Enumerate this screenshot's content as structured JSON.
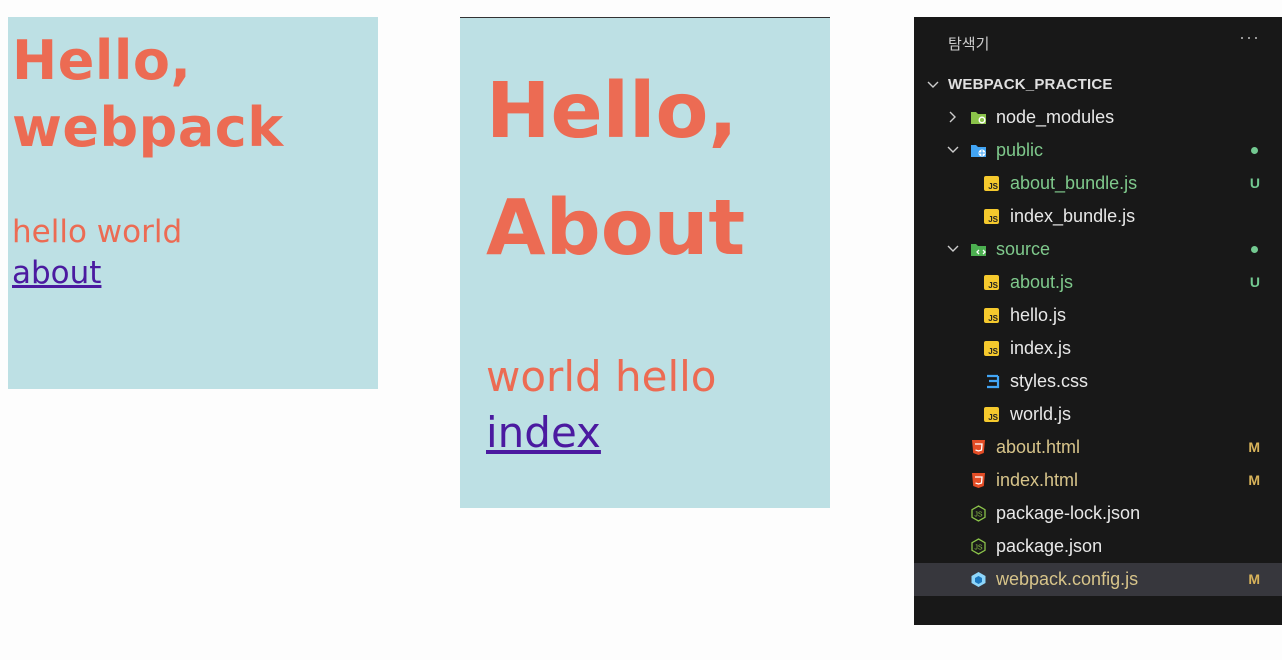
{
  "panel_index": {
    "heading": "Hello, webpack",
    "text": "hello world",
    "link": "about"
  },
  "panel_about": {
    "heading": "Hello, About",
    "text": "world hello",
    "link": "index"
  },
  "explorer": {
    "title": "탐색기",
    "more": "···",
    "root": "WEBPACK_PRACTICE",
    "items": [
      {
        "name": "node_modules",
        "type": "folder",
        "icon": "folder-node-icon",
        "badge": ""
      },
      {
        "name": "public",
        "type": "folder",
        "icon": "folder-public-icon",
        "badge": ""
      },
      {
        "name": "about_bundle.js",
        "type": "file",
        "icon": "js-file-icon",
        "badge": "U"
      },
      {
        "name": "index_bundle.js",
        "type": "file",
        "icon": "js-file-icon",
        "badge": ""
      },
      {
        "name": "source",
        "type": "folder",
        "icon": "folder-source-icon",
        "badge": ""
      },
      {
        "name": "about.js",
        "type": "file",
        "icon": "js-file-icon",
        "badge": "U"
      },
      {
        "name": "hello.js",
        "type": "file",
        "icon": "js-file-icon",
        "badge": ""
      },
      {
        "name": "index.js",
        "type": "file",
        "icon": "js-file-icon",
        "badge": ""
      },
      {
        "name": "styles.css",
        "type": "file",
        "icon": "css-file-icon",
        "badge": ""
      },
      {
        "name": "world.js",
        "type": "file",
        "icon": "js-file-icon",
        "badge": ""
      },
      {
        "name": "about.html",
        "type": "file",
        "icon": "html-file-icon",
        "badge": "M"
      },
      {
        "name": "index.html",
        "type": "file",
        "icon": "html-file-icon",
        "badge": "M"
      },
      {
        "name": "package-lock.json",
        "type": "file",
        "icon": "node-json-icon",
        "badge": ""
      },
      {
        "name": "package.json",
        "type": "file",
        "icon": "node-json-icon",
        "badge": ""
      },
      {
        "name": "webpack.config.js",
        "type": "file",
        "icon": "webpack-icon",
        "badge": "M"
      }
    ],
    "colors": {
      "background": "#181818",
      "untracked": "#73c991",
      "modified": "#d8b35a",
      "selected_row": "#37373d"
    }
  },
  "colors": {
    "panel_bg": "#bde0e4",
    "heading": "#ec6b53",
    "link": "#4b1aa0"
  }
}
